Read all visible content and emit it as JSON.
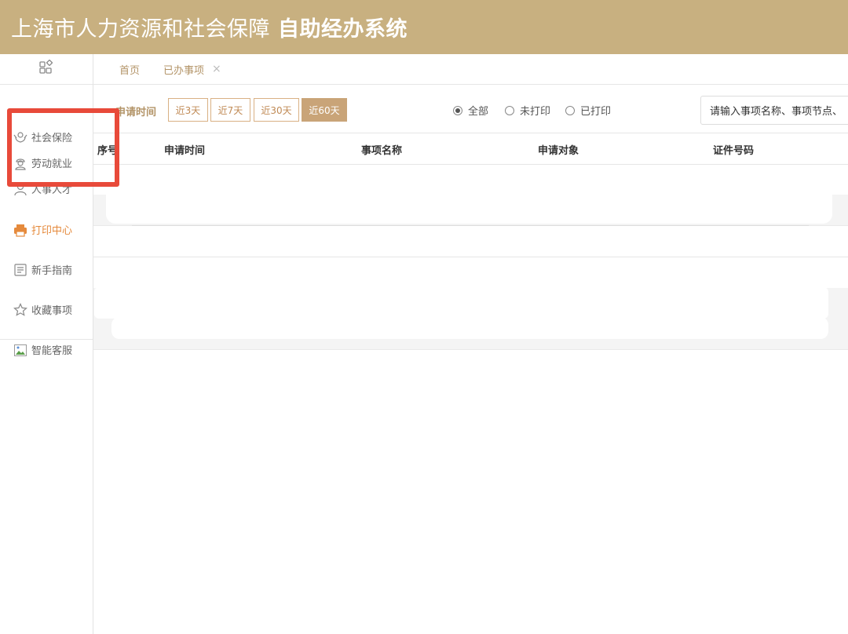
{
  "header": {
    "title_regular": "上海市人力资源和社会保障",
    "title_bold": "自助经办系统"
  },
  "sidebar": {
    "top_icon": "grid-apps-icon",
    "items": [
      {
        "label": "社会保险",
        "icon": "social-insurance-icon"
      },
      {
        "label": "劳动就业",
        "icon": "worker-icon"
      },
      {
        "label": "人事人才",
        "icon": "user-icon"
      },
      {
        "label": "打印中心",
        "icon": "printer-icon",
        "active": true
      },
      {
        "label": "新手指南",
        "icon": "guide-icon"
      },
      {
        "label": "收藏事项",
        "icon": "star-icon"
      },
      {
        "label": "智能客服",
        "icon": "broken-image-icon"
      }
    ]
  },
  "tabs": [
    {
      "label": "首页"
    },
    {
      "label": "已办事项",
      "closable": true,
      "close_glyph": "×"
    }
  ],
  "filter": {
    "label": "申请时间",
    "ranges": [
      "近3天",
      "近7天",
      "近30天",
      "近60天"
    ],
    "active_range": "近60天",
    "radios": [
      "全部",
      "未打印",
      "已打印"
    ],
    "selected_radio": "全部",
    "search_placeholder": "请输入事项名称、事项节点、"
  },
  "table": {
    "columns": [
      "序号",
      "申请时间",
      "事项名称",
      "申请对象",
      "证件号码"
    ]
  },
  "colors": {
    "header_bg": "#c8b080",
    "accent": "#c9a478",
    "active_nav": "#e58a3c",
    "highlight": "#e84a3a"
  }
}
